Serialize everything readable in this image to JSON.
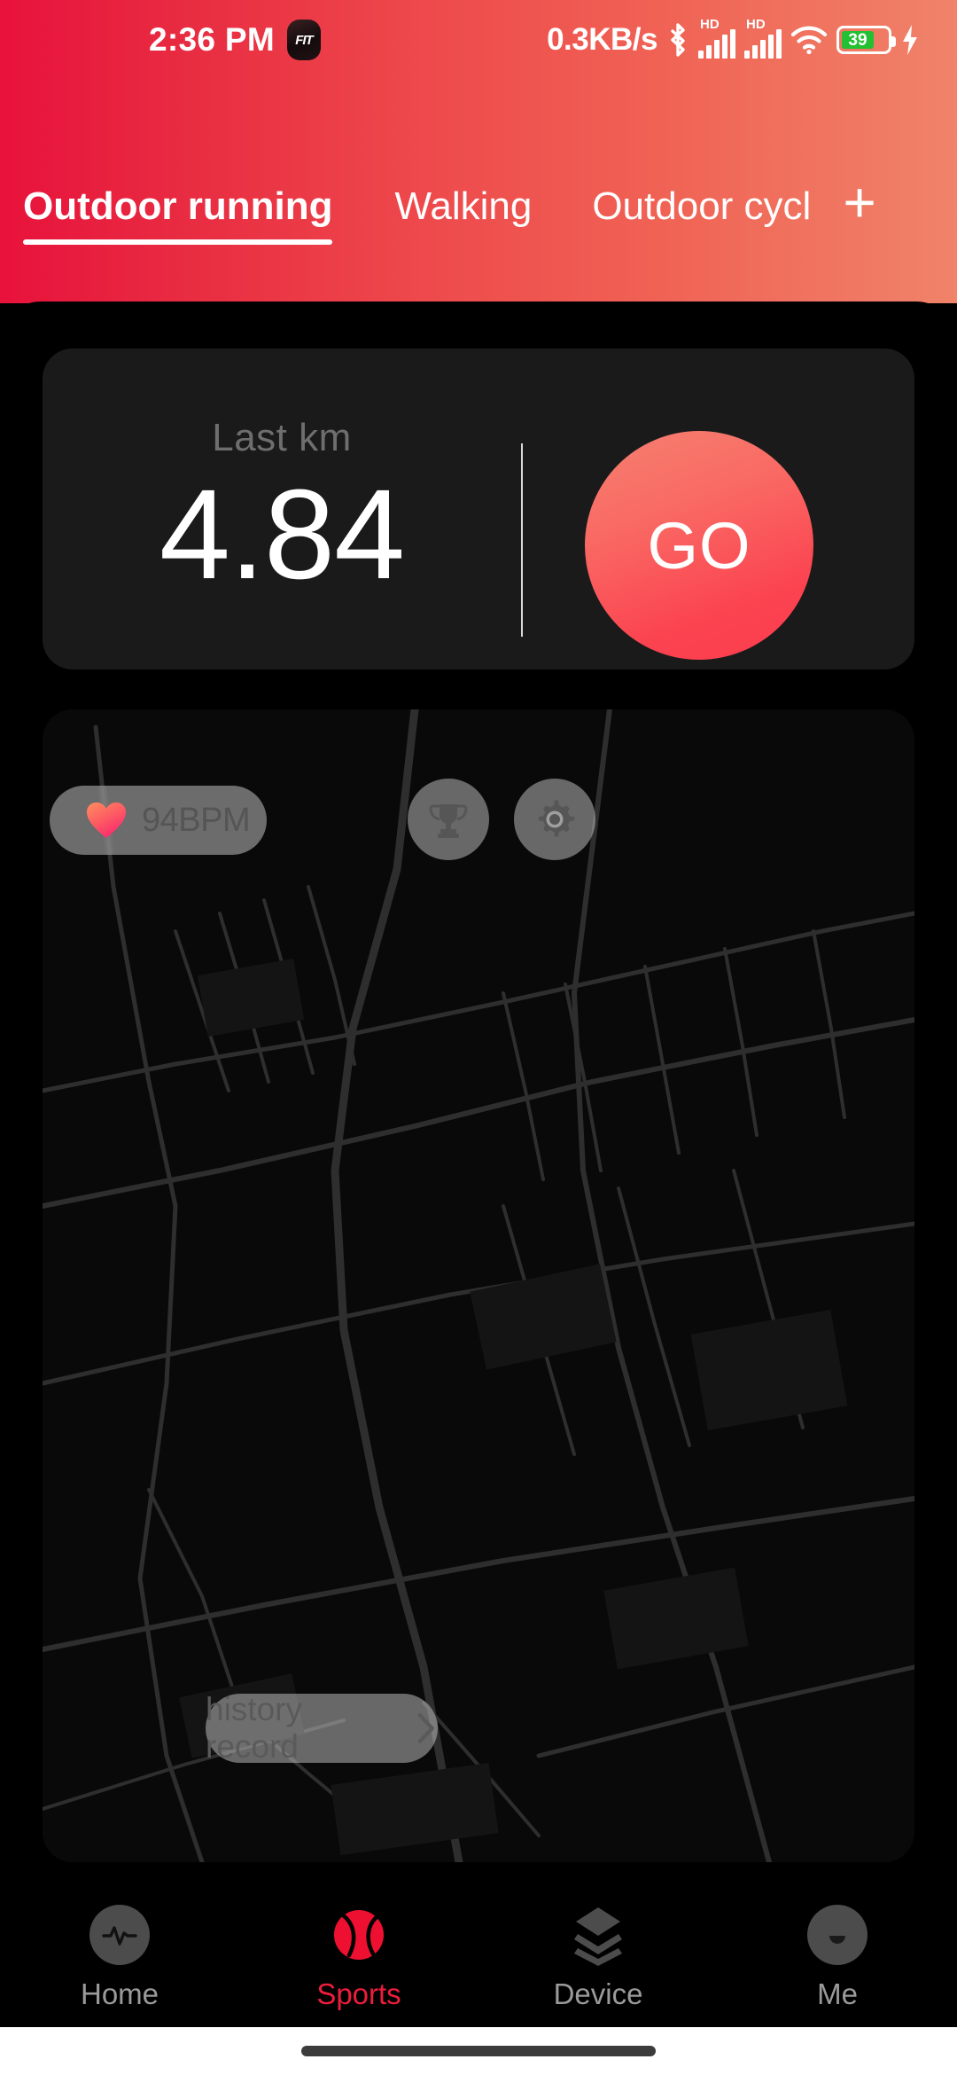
{
  "status_bar": {
    "time": "2:36 PM",
    "app_badge": "FIT",
    "network_speed": "0.3KB/s",
    "bluetooth_icon": "bluetooth-icon",
    "sim1_label": "HD",
    "sim2_label": "HD",
    "wifi_icon": "wifi-icon",
    "battery_level": "39",
    "charging_icon": "charging-bolt-icon"
  },
  "tabs": {
    "items": [
      {
        "label": "Outdoor running",
        "active": true
      },
      {
        "label": "Walking",
        "active": false
      },
      {
        "label": "Outdoor cycl",
        "active": false
      }
    ],
    "add_label": "+"
  },
  "stat_card": {
    "label": "Last km",
    "value": "4.84",
    "go_label": "GO"
  },
  "map": {
    "heart_rate": "94BPM",
    "heart_icon": "heart-icon",
    "trophy_icon": "trophy-icon",
    "settings_icon": "gear-icon",
    "history_label": "history record",
    "history_chevron": "chevron-right-icon"
  },
  "bottom_nav": {
    "items": [
      {
        "label": "Home",
        "icon": "heartbeat-icon",
        "active": false
      },
      {
        "label": "Sports",
        "icon": "sports-ball-icon",
        "active": true
      },
      {
        "label": "Device",
        "icon": "layers-icon",
        "active": false
      },
      {
        "label": "Me",
        "icon": "avatar-icon",
        "active": false
      }
    ]
  },
  "colors": {
    "header_gradient_start": "#e8123c",
    "header_gradient_end": "#f0836a",
    "accent_red": "#ee1d3c",
    "go_button_start": "#f58070",
    "go_button_end": "#fc3c4e",
    "card_bg": "#1a1a1a",
    "battery_green": "#22c032"
  }
}
